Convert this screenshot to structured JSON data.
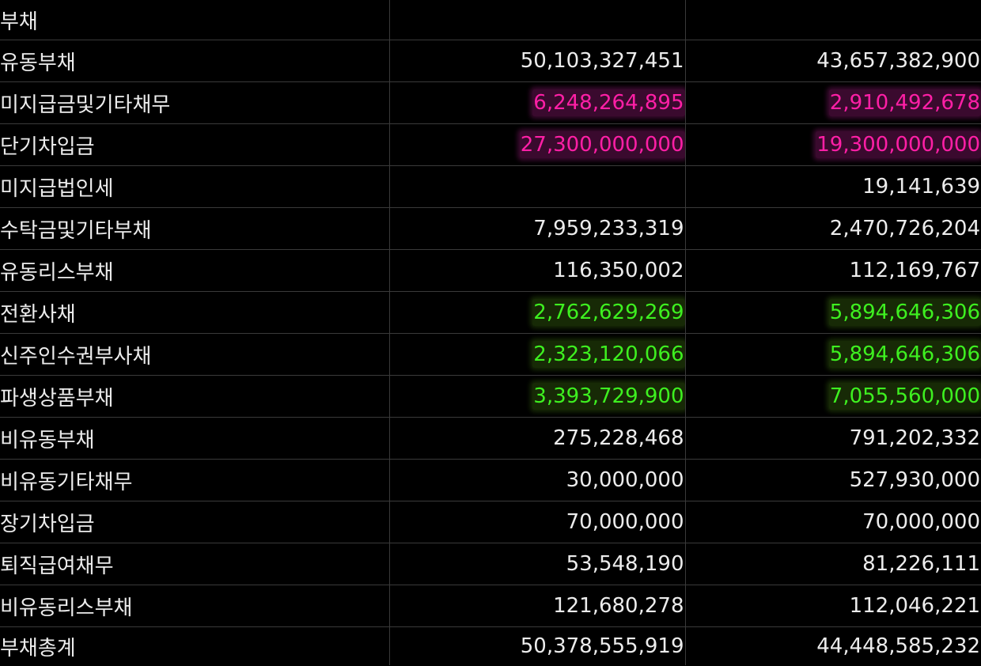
{
  "rows": [
    {
      "label": "부채",
      "level": 0,
      "current": "",
      "previous": "",
      "highlight": ""
    },
    {
      "label": "유동부채",
      "level": 1,
      "current": "50,103,327,451",
      "previous": "43,657,382,900",
      "highlight": ""
    },
    {
      "label": "미지급금및기타채무",
      "level": 2,
      "current": "6,248,264,895",
      "previous": "2,910,492,678",
      "highlight": "pink"
    },
    {
      "label": "단기차입금",
      "level": 2,
      "current": "27,300,000,000",
      "previous": "19,300,000,000",
      "highlight": "pink"
    },
    {
      "label": "미지급법인세",
      "level": 2,
      "current": "",
      "previous": "19,141,639",
      "highlight": ""
    },
    {
      "label": "수탁금및기타부채",
      "level": 2,
      "current": "7,959,233,319",
      "previous": "2,470,726,204",
      "highlight": ""
    },
    {
      "label": "유동리스부채",
      "level": 2,
      "current": "116,350,002",
      "previous": "112,169,767",
      "highlight": ""
    },
    {
      "label": "전환사채",
      "level": 2,
      "current": "2,762,629,269",
      "previous": "5,894,646,306",
      "highlight": "green"
    },
    {
      "label": "신주인수권부사채",
      "level": 2,
      "current": "2,323,120,066",
      "previous": "5,894,646,306",
      "highlight": "green"
    },
    {
      "label": "파생상품부채",
      "level": 2,
      "current": "3,393,729,900",
      "previous": "7,055,560,000",
      "highlight": "green"
    },
    {
      "label": "비유동부채",
      "level": 1,
      "current": "275,228,468",
      "previous": "791,202,332",
      "highlight": ""
    },
    {
      "label": "비유동기타채무",
      "level": 2,
      "current": "30,000,000",
      "previous": "527,930,000",
      "highlight": ""
    },
    {
      "label": "장기차입금",
      "level": 2,
      "current": "70,000,000",
      "previous": "70,000,000",
      "highlight": ""
    },
    {
      "label": "퇴직급여채무",
      "level": 2,
      "current": "53,548,190",
      "previous": "81,226,111",
      "highlight": ""
    },
    {
      "label": "비유동리스부채",
      "level": 2,
      "current": "121,680,278",
      "previous": "112,046,221",
      "highlight": ""
    },
    {
      "label": "부채총계",
      "level": 1,
      "current": "50,378,555,919",
      "previous": "44,448,585,232",
      "highlight": ""
    }
  ],
  "colors": {
    "background": "#000000",
    "text": "#ececec",
    "grid": "#3a3a3a",
    "pink_text": "#ff1fa6",
    "pink_bg": "#3a0a2e",
    "green_text": "#3ef020",
    "green_bg": "#172a06"
  }
}
